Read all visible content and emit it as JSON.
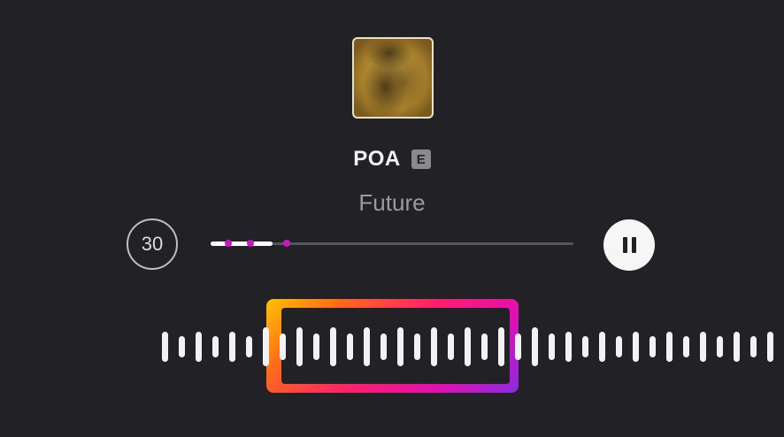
{
  "song": {
    "title": "POA",
    "explicit_badge": "E",
    "artist": "Future"
  },
  "controls": {
    "skip_label": "30",
    "progress_fraction": 0.17
  },
  "colors": {
    "background": "#222226",
    "accent_marker": "#d013c8",
    "selection_gradient": [
      "#ffc400",
      "#ff1f6b",
      "#8a2be2"
    ]
  },
  "icons": {
    "pause": "pause-icon",
    "skip": "skip-30-icon"
  }
}
